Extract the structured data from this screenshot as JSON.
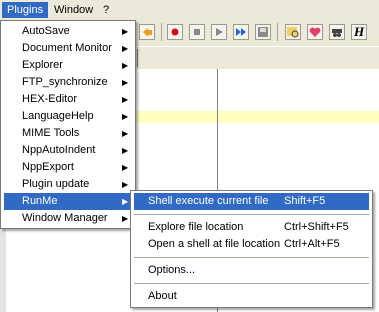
{
  "menubar": {
    "items": [
      "Plugins",
      "Window",
      "?"
    ]
  },
  "toolbar": {
    "icons": [
      "undo-icon",
      "record-macro-icon",
      "stop-record-icon",
      "play-macro-icon",
      "run-macro-multiple-icon",
      "save-macro-icon",
      "find-icon",
      "favorite-icon",
      "incognito-icon",
      "syntax-icon"
    ],
    "syntax_glyph": "H"
  },
  "plugins_menu": {
    "items": [
      {
        "label": "AutoSave"
      },
      {
        "label": "Document Monitor"
      },
      {
        "label": "Explorer"
      },
      {
        "label": "FTP_synchronize"
      },
      {
        "label": "HEX-Editor"
      },
      {
        "label": "LanguageHelp"
      },
      {
        "label": "MIME Tools"
      },
      {
        "label": "NppAutoIndent"
      },
      {
        "label": "NppExport"
      },
      {
        "label": "Plugin update"
      },
      {
        "label": "RunMe"
      },
      {
        "label": "Window Manager"
      }
    ],
    "selected_index": 10
  },
  "runme_submenu": {
    "items": [
      {
        "label": "Shell execute current file",
        "shortcut": "Shift+F5"
      },
      {
        "label": "Explore file location",
        "shortcut": "Ctrl+Shift+F5"
      },
      {
        "label": "Open a shell at file location",
        "shortcut": "Ctrl+Alt+F5"
      },
      {
        "label": "Options...",
        "shortcut": ""
      },
      {
        "label": "About",
        "shortcut": ""
      }
    ],
    "selected_index": 0
  },
  "colors": {
    "highlight": "#316ac5",
    "current_line": "#ffffc0"
  },
  "arrow_glyph": "▶"
}
